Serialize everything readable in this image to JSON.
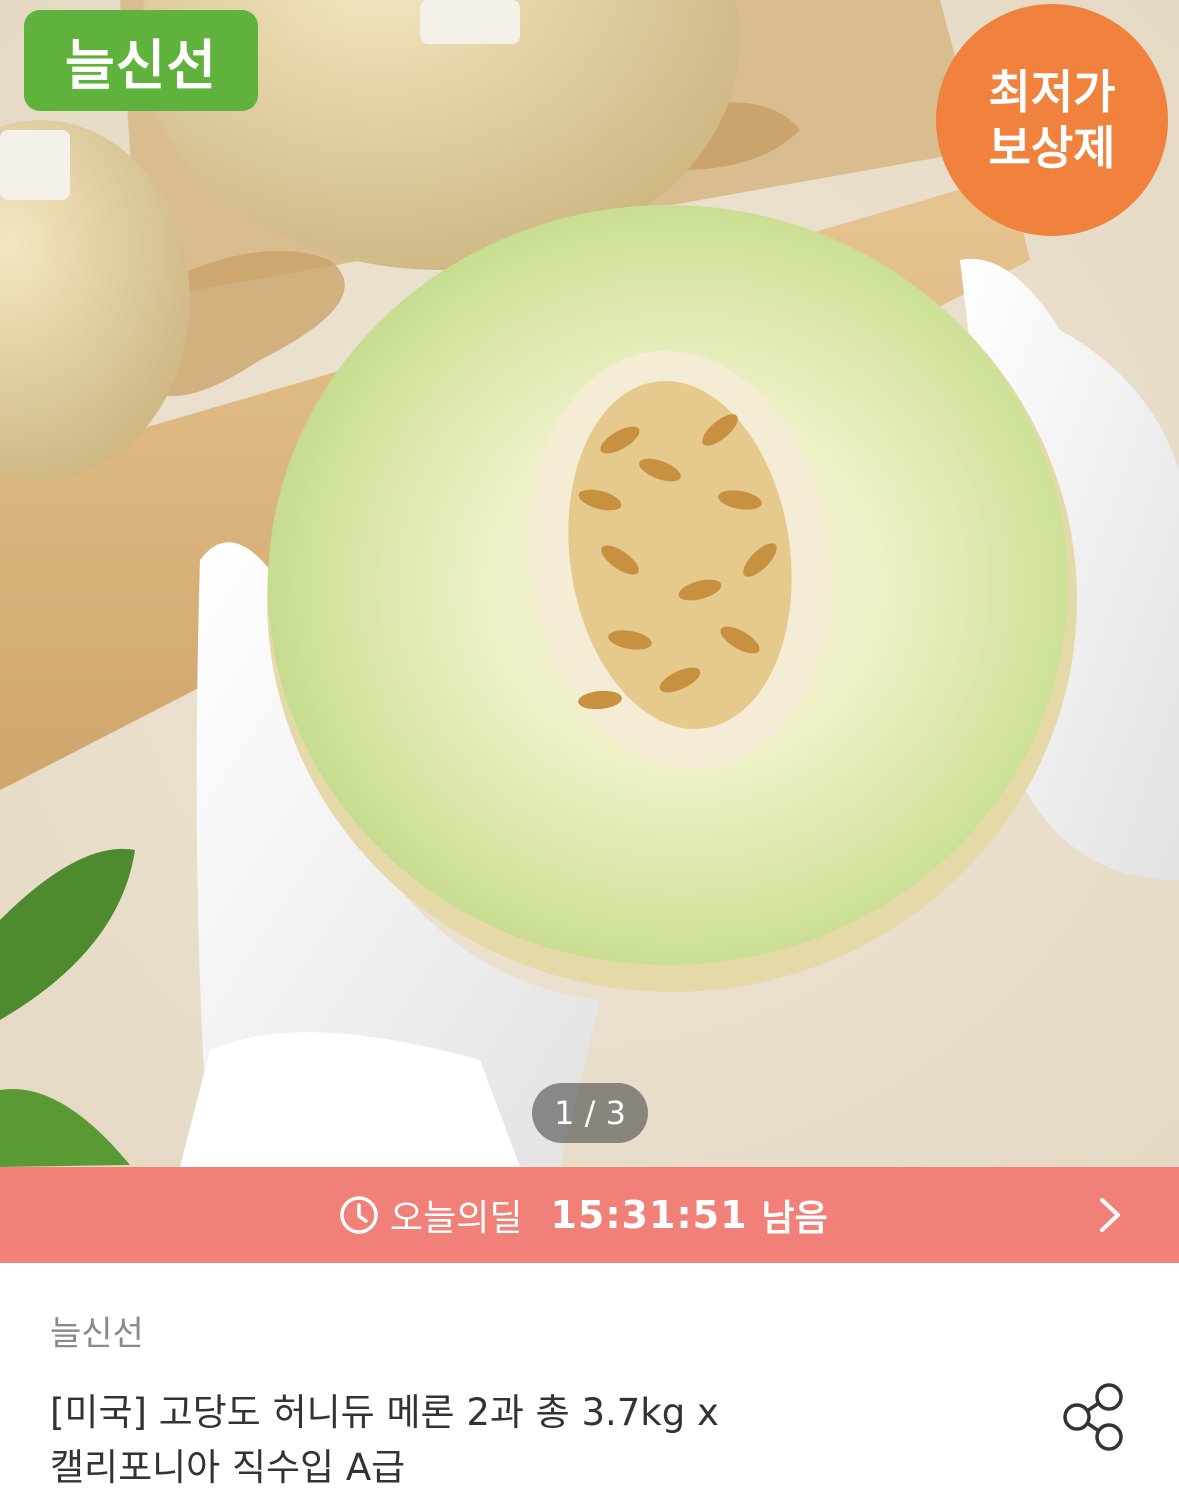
{
  "badges": {
    "brand": "늘신선",
    "price_line1": "최저가",
    "price_line2": "보상제"
  },
  "pager": "1 / 3",
  "deal": {
    "label": "오늘의딜",
    "time": "15:31:51",
    "remaining": "남음"
  },
  "product": {
    "seller": "늘신선",
    "title_line1": "[미국] 고당도 허니듀 메론 2과 총 3.7kg x",
    "title_line2": "캘리포니아 직수입 A급"
  },
  "colors": {
    "brand_green": "#5fb33c",
    "badge_orange": "#f0823e",
    "deal_bar": "#f08078"
  }
}
